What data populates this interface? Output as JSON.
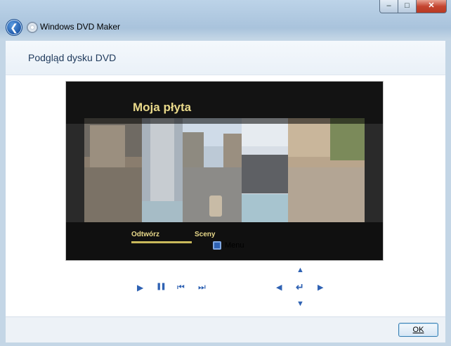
{
  "window": {
    "app_title": "Windows DVD Maker",
    "controls": {
      "minimize": "–",
      "maximize": "□",
      "close": "✕"
    }
  },
  "header": {
    "title": "Podgląd dysku DVD"
  },
  "dvd_preview": {
    "disc_title": "Moja płyta",
    "menu_items": [
      "Odtwórz",
      "Sceny"
    ],
    "selected_item": "Odtwórz"
  },
  "playback_controls": {
    "play": "▶",
    "pause": "❚❚",
    "previous": "⏮",
    "next": "⏭",
    "menu_label": "Menu",
    "nav_left": "◀",
    "nav_up": "▲",
    "nav_down": "▼",
    "nav_right": "▶",
    "enter": "↵"
  },
  "footer": {
    "ok_label": "OK"
  },
  "icons": {
    "back": "arrow-left-icon",
    "app": "dvd-disc-icon",
    "menu": "menu-icon"
  }
}
